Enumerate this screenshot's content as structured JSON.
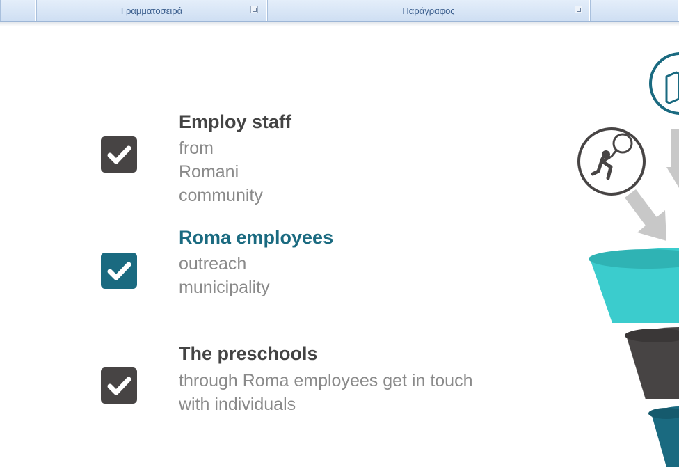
{
  "ribbon": {
    "groups": [
      {
        "label": ""
      },
      {
        "label": "Γραμματοσειρά"
      },
      {
        "label": "Παράγραφος"
      },
      {
        "label": ""
      }
    ]
  },
  "slide": {
    "items": [
      {
        "title": "Employ staff",
        "subtitle": "from Romani community",
        "color": "#474444"
      },
      {
        "title": "Roma employees",
        "subtitle": "outreach municipality",
        "color": "#1a6a80"
      },
      {
        "title": "The preschools",
        "subtitle": "through Roma employees get in touch with individuals",
        "color": "#474444"
      },
      {
        "title": "",
        "subtitle": "",
        "color": "#1a6a80"
      }
    ]
  },
  "colors": {
    "teal": "#1a6a80",
    "dark": "#474444",
    "cyan": "#3bcccd",
    "arrow_gray": "#c8c8c8"
  }
}
